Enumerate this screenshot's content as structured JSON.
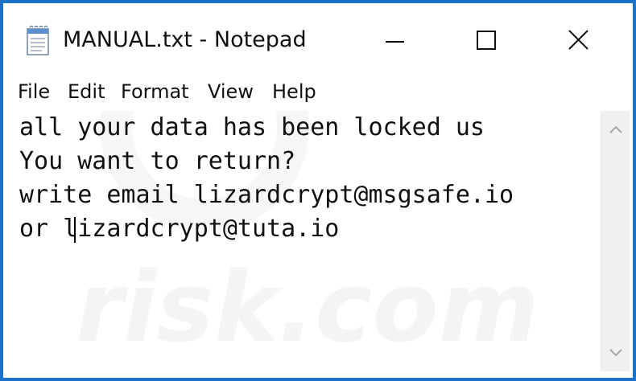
{
  "window": {
    "title": "MANUAL.txt - Notepad"
  },
  "icons": {
    "app": "notepad-icon",
    "minimize": "minimize-icon",
    "maximize": "maximize-icon",
    "close": "close-icon",
    "scroll_up": "chevron-up-icon",
    "scroll_down": "chevron-down-icon"
  },
  "menu": {
    "items": [
      {
        "label": "File"
      },
      {
        "label": "Edit"
      },
      {
        "label": "Format"
      },
      {
        "label": "View"
      },
      {
        "label": "Help"
      }
    ]
  },
  "editor": {
    "lines": [
      "all your data has been locked us",
      "You want to return?",
      "write email lizardcrypt@msgsafe.io",
      "or lizardcrypt@tuta.io"
    ]
  },
  "watermark": {
    "text": "risk.com"
  },
  "colors": {
    "desktop": "#1a73c8",
    "window": "#ffffff",
    "text": "#111111",
    "scrollbar": "#f0f0f0"
  }
}
